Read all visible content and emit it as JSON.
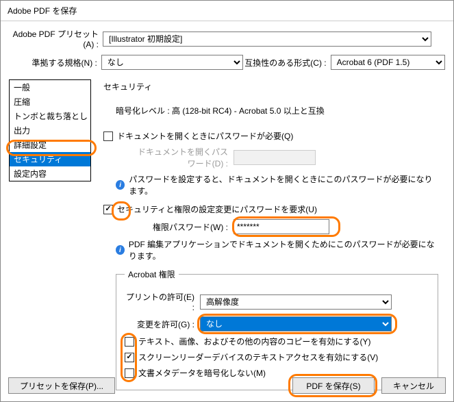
{
  "title": "Adobe PDF を保存",
  "preset": {
    "label": "Adobe PDF プリセット(A) :",
    "value": "[Illustrator 初期設定]"
  },
  "norm": {
    "label": "準拠する規格(N) :",
    "value": "なし"
  },
  "compat": {
    "label": "互換性のある形式(C) :",
    "value": "Acrobat 6 (PDF 1.5)"
  },
  "sidebar": {
    "items": [
      {
        "label": "一般"
      },
      {
        "label": "圧縮"
      },
      {
        "label": "トンボと裁ち落とし"
      },
      {
        "label": "出力"
      },
      {
        "label": "詳細設定"
      },
      {
        "label": "セキュリティ"
      },
      {
        "label": "設定内容"
      }
    ]
  },
  "panel": {
    "title": "セキュリティ",
    "enc_level": "暗号化レベル : 高 (128-bit RC4) - Acrobat 5.0 以上と互換",
    "open_pw_req": "ドキュメントを開くときにパスワードが必要(Q)",
    "open_pw_label": "ドキュメントを開くパスワード(D) :",
    "open_pw_info": "パスワードを設定すると、ドキュメントを開くときにこのパスワードが必要になります。",
    "perm_pw_req": "セキュリティと権限の設定変更にパスワードを要求(U)",
    "perm_pw_label": "権限パスワード(W) :",
    "perm_pw_value": "*******",
    "perm_pw_info": "PDF 編集アプリケーションでドキュメントを開くためにこのパスワードが必要になります。",
    "group": "Acrobat 権限",
    "print_label": "プリントの許可(E) :",
    "print_value": "高解像度",
    "change_label": "変更を許可(G) :",
    "change_value": "なし",
    "copy_label": "テキスト、画像、およびその他の内容のコピーを有効にする(Y)",
    "reader_label": "スクリーンリーダーデバイスのテキストアクセスを有効にする(V)",
    "meta_label": "文書メタデータを暗号化しない(M)"
  },
  "footer": {
    "save_preset": "プリセットを保存(P)...",
    "save_pdf": "PDF を保存(S)",
    "cancel": "キャンセル"
  }
}
